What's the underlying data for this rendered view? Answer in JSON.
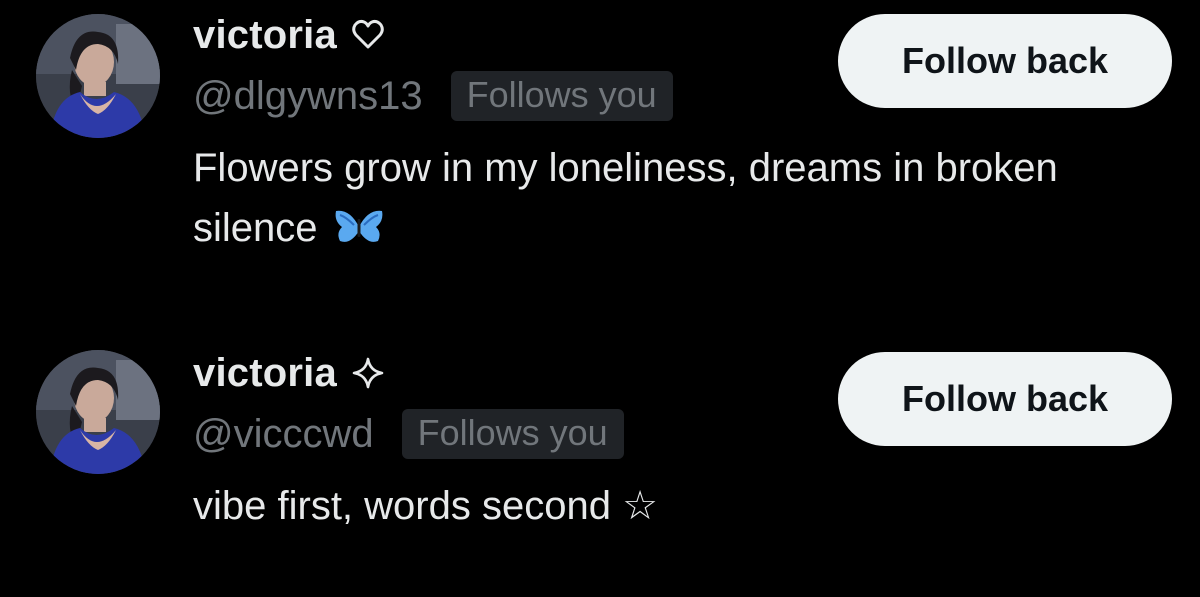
{
  "users": [
    {
      "display_name": "victoria",
      "name_icon": "heart-outline-icon",
      "handle": "@dlgywns13",
      "follows_badge": "Follows you",
      "bio": "Flowers grow in my loneliness, dreams in broken silence",
      "bio_emoji": "butterfly-icon",
      "button_label": "Follow back"
    },
    {
      "display_name": "victoria",
      "name_icon": "sparkle-outline-icon",
      "handle": "@vicccwd",
      "follows_badge": "Follows you",
      "bio": "vibe first, words second ☆",
      "bio_emoji": "",
      "button_label": "Follow back"
    }
  ],
  "colors": {
    "background": "#000000",
    "primary_text": "#e7e9ea",
    "secondary_text": "#71767b",
    "badge_background": "#202327",
    "button_background": "#eff3f4",
    "button_text": "#0f1419",
    "butterfly": "#5aa9f0"
  }
}
